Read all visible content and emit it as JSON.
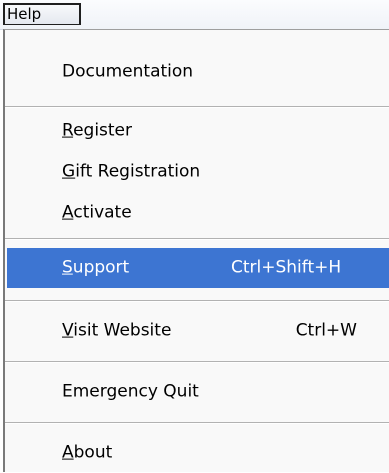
{
  "menubar": {
    "help_label": "Help"
  },
  "menu": {
    "documentation": {
      "mnemonic": "",
      "rest": "Documentation"
    },
    "register": {
      "mnemonic": "R",
      "rest": "egister"
    },
    "gift_registration": {
      "mnemonic": "G",
      "rest": "ift Registration"
    },
    "activate": {
      "mnemonic": "A",
      "rest": "ctivate"
    },
    "support": {
      "mnemonic": "S",
      "rest": "upport",
      "shortcut": "Ctrl+Shift+H"
    },
    "visit_website": {
      "mnemonic": "V",
      "rest": "isit Website",
      "shortcut": "Ctrl+W"
    },
    "emergency_quit": {
      "mnemonic": "",
      "rest": "Emergency Quit"
    },
    "about": {
      "mnemonic": "A",
      "rest": "bout"
    }
  },
  "colors": {
    "highlight": "#3d75d2",
    "highlight_text": "#ffffff"
  }
}
